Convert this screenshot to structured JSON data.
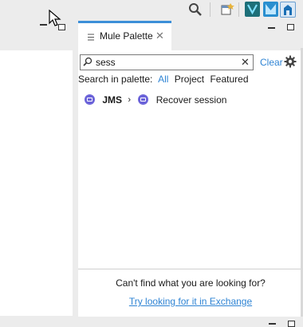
{
  "toolbar": {
    "icons": [
      "search-icon",
      "open-perspective-icon",
      "perspective-mule-icon",
      "perspective-design-icon",
      "perspective-home-icon"
    ]
  },
  "palette": {
    "tab_label": "Mule Palette",
    "search": {
      "value": "sess",
      "clear_label": "Clear"
    },
    "filter": {
      "prefix": "Search in palette:",
      "options": [
        "All",
        "Project",
        "Featured"
      ],
      "selected": "All"
    },
    "results": [
      {
        "module": "JMS",
        "operation": "Recover session"
      }
    ],
    "footer": {
      "question": "Can't find what you are looking for?",
      "link": "Try looking for it in Exchange"
    }
  },
  "colors": {
    "accent": "#3c8fd8",
    "link": "#2f84d4",
    "operation_icon": "#6b63d9"
  }
}
